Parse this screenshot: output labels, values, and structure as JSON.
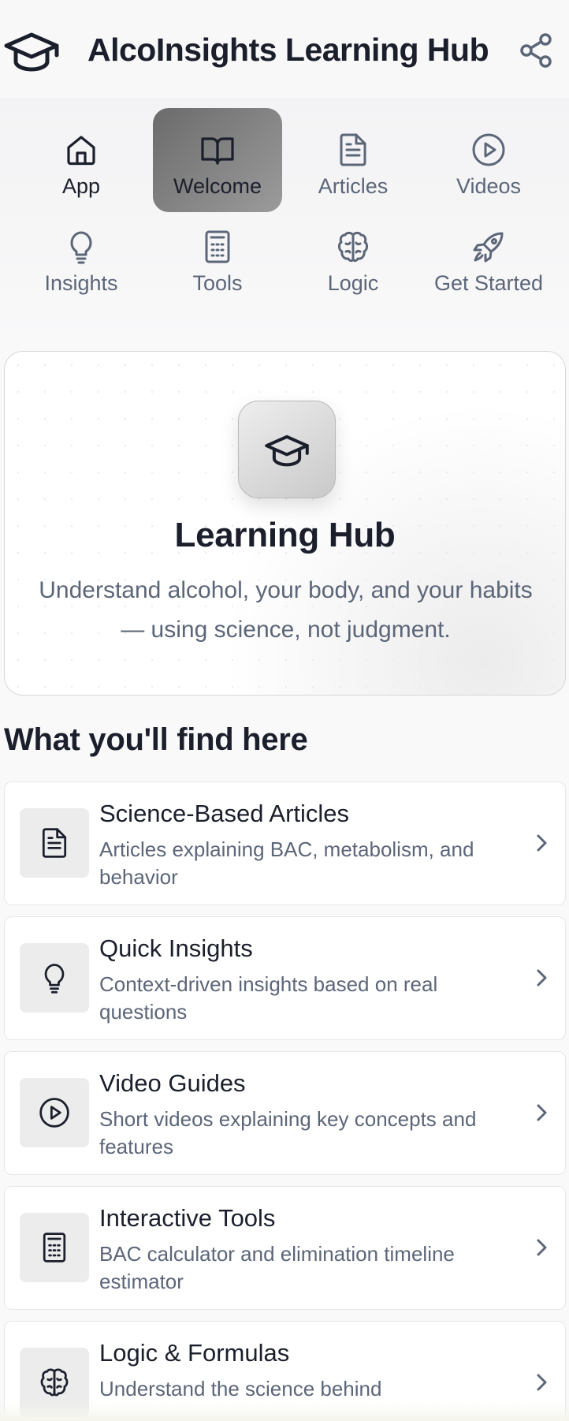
{
  "header": {
    "title": "AlcoInsights Learning Hub",
    "logo_icon": "graduation-cap-icon",
    "share_icon": "share-icon"
  },
  "nav": {
    "items": [
      {
        "label": "App",
        "icon": "home-icon"
      },
      {
        "label": "Welcome",
        "icon": "book-open-icon",
        "active": true
      },
      {
        "label": "Articles",
        "icon": "file-text-icon"
      },
      {
        "label": "Videos",
        "icon": "play-circle-icon"
      },
      {
        "label": "Insights",
        "icon": "lightbulb-icon"
      },
      {
        "label": "Tools",
        "icon": "calculator-icon"
      },
      {
        "label": "Logic",
        "icon": "brain-icon"
      },
      {
        "label": "Get Started",
        "icon": "rocket-icon"
      }
    ]
  },
  "hero": {
    "icon": "graduation-cap-icon",
    "title": "Learning Hub",
    "subtitle": "Understand alcohol, your body, and your habits — using science, not judgment."
  },
  "section": {
    "title": "What you'll find here"
  },
  "features": [
    {
      "title": "Science-Based Articles",
      "description": "Articles explaining BAC, metabolism, and behavior",
      "icon": "file-text-icon"
    },
    {
      "title": "Quick Insights",
      "description": "Context-driven insights based on real questions",
      "icon": "lightbulb-icon"
    },
    {
      "title": "Video Guides",
      "description": "Short videos explaining key concepts and features",
      "icon": "play-circle-icon"
    },
    {
      "title": "Interactive Tools",
      "description": "BAC calculator and elimination timeline estimator",
      "icon": "calculator-icon"
    },
    {
      "title": "Logic & Formulas",
      "description": "Understand the science behind",
      "icon": "brain-icon"
    }
  ],
  "colors": {
    "text_primary": "#1b1f2c",
    "text_secondary": "#5c6679",
    "active_tab_start": "#6b6b6b",
    "active_tab_end": "#9b9b9b"
  }
}
